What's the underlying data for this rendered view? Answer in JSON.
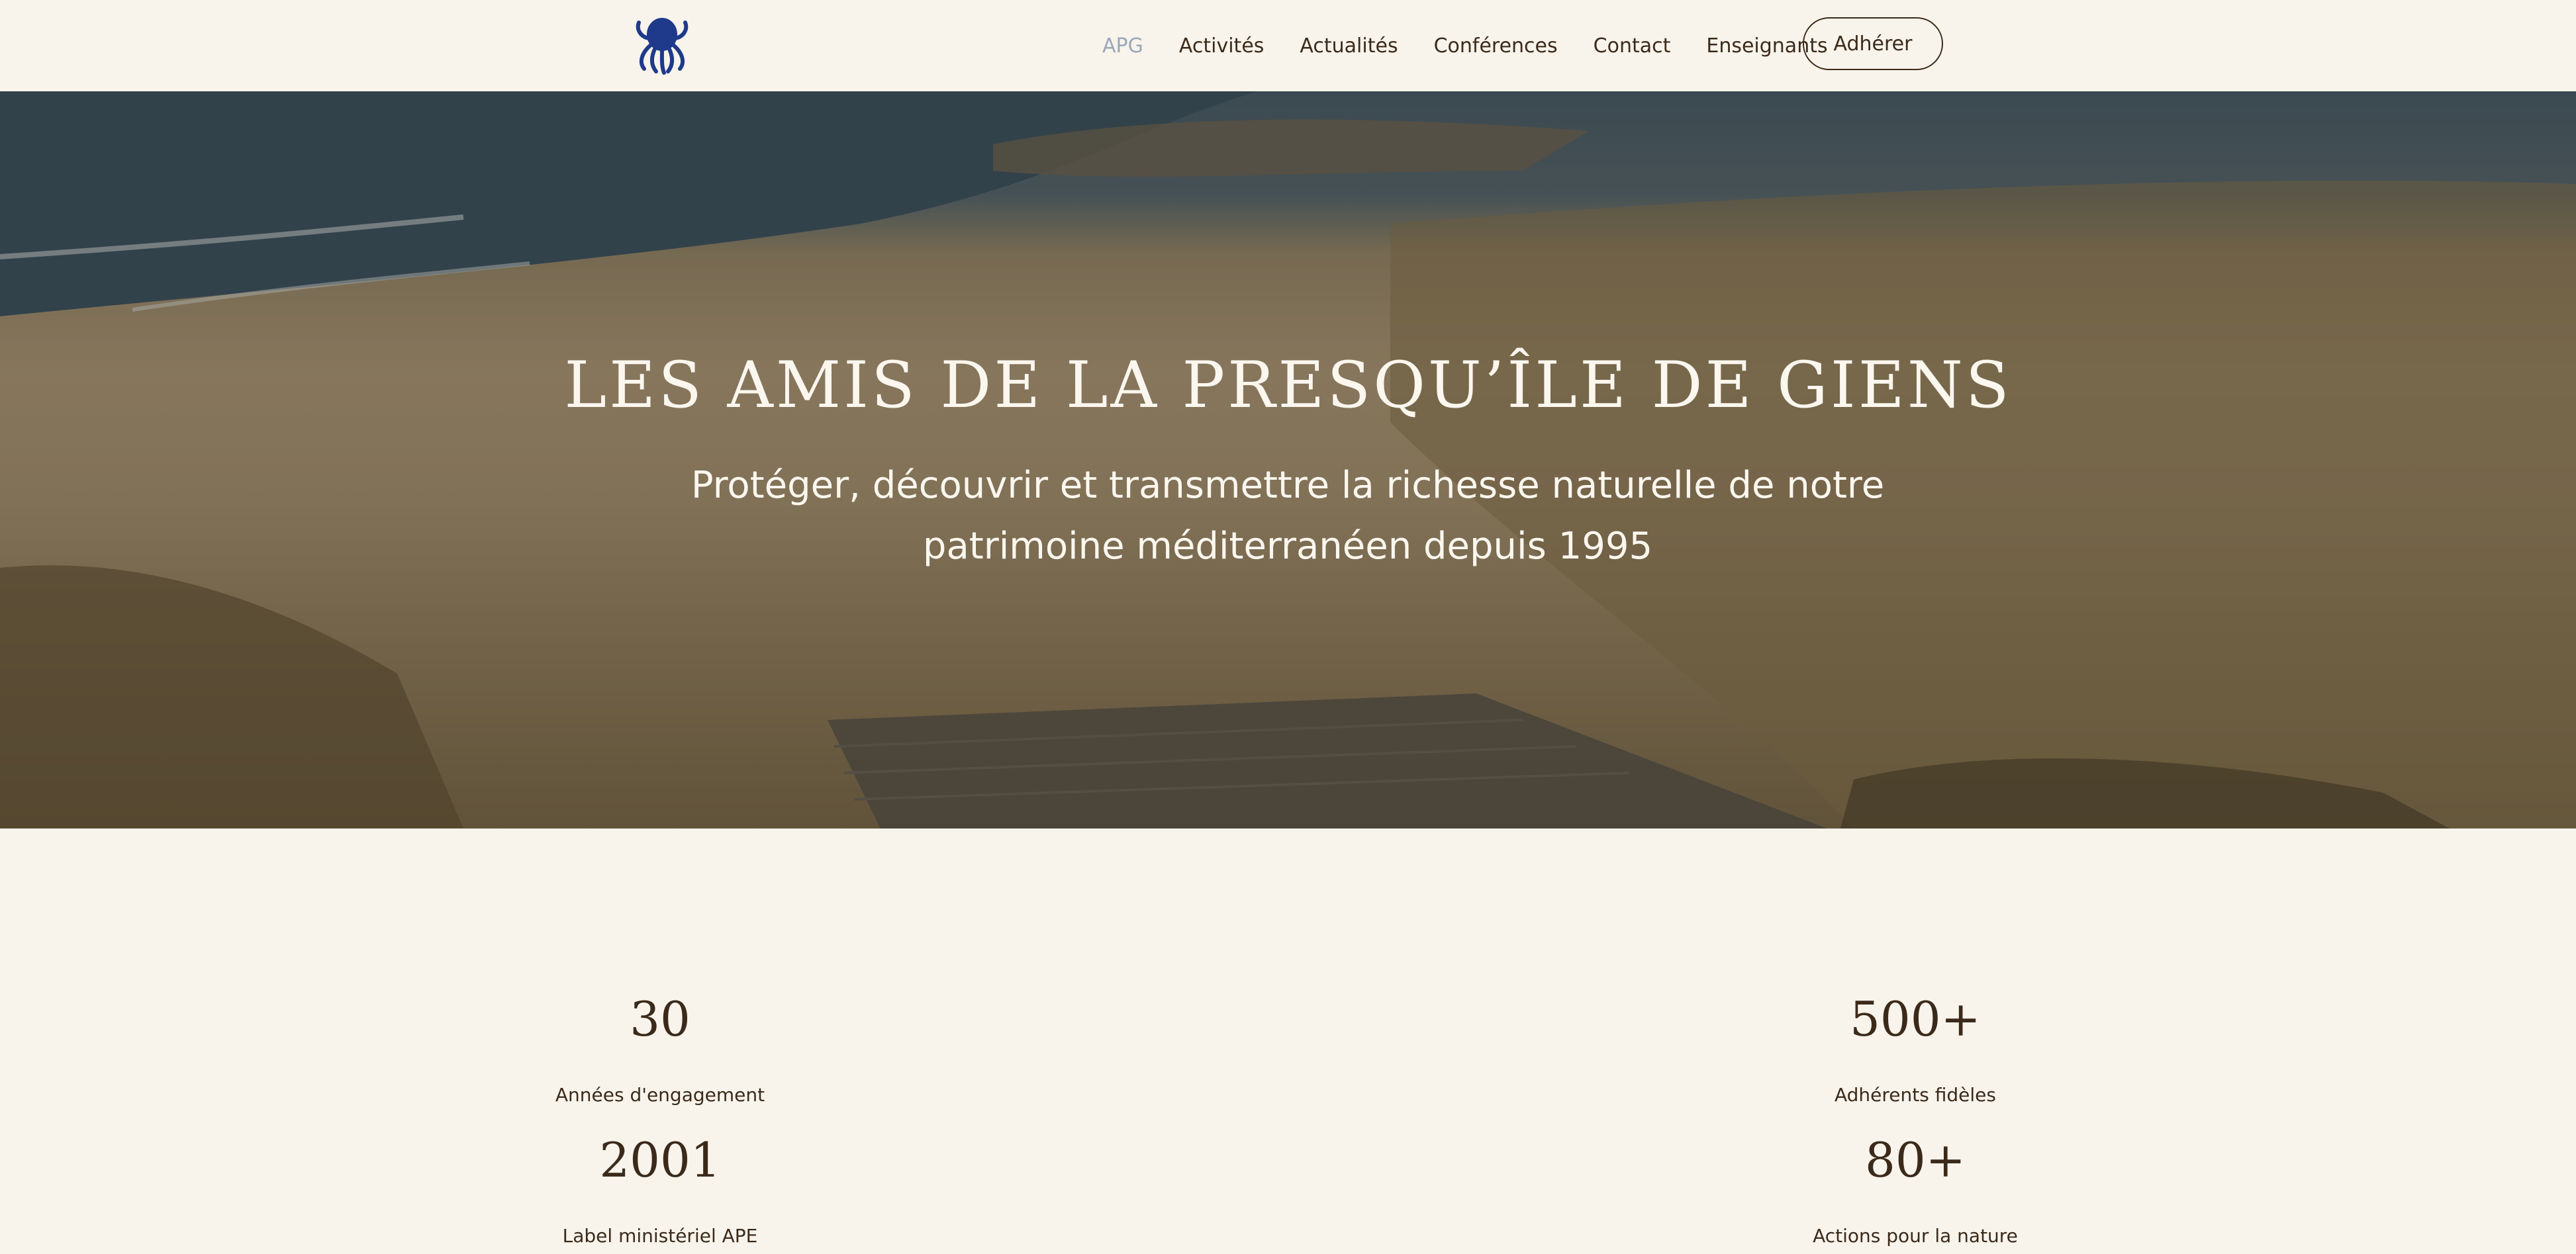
{
  "header": {
    "logo_icon": "octopus-logo-icon",
    "nav": [
      {
        "label": "APG",
        "active": true
      },
      {
        "label": "Activités",
        "active": false
      },
      {
        "label": "Actualités",
        "active": false
      },
      {
        "label": "Conférences",
        "active": false
      },
      {
        "label": "Contact",
        "active": false
      },
      {
        "label": "Enseignants",
        "active": false
      }
    ],
    "join_label": "Adhérer"
  },
  "hero": {
    "title": "LES AMIS DE LA PRESQU’ÎLE DE GIENS",
    "subtitle": "Protéger, découvrir et transmettre la richesse naturelle de notre patrimoine méditerranéen depuis 1995"
  },
  "stats": [
    {
      "value": "30",
      "label": "Années d'engagement"
    },
    {
      "value": "500+",
      "label": "Adhérents fidèles"
    },
    {
      "value": "2001",
      "label": "Label ministériel APE"
    },
    {
      "value": "80+",
      "label": "Actions pour la nature"
    }
  ],
  "colors": {
    "background": "#f8f4ec",
    "text": "#3b2a1a",
    "nav_active": "#9aa7b8",
    "logo": "#1f3a8a"
  }
}
